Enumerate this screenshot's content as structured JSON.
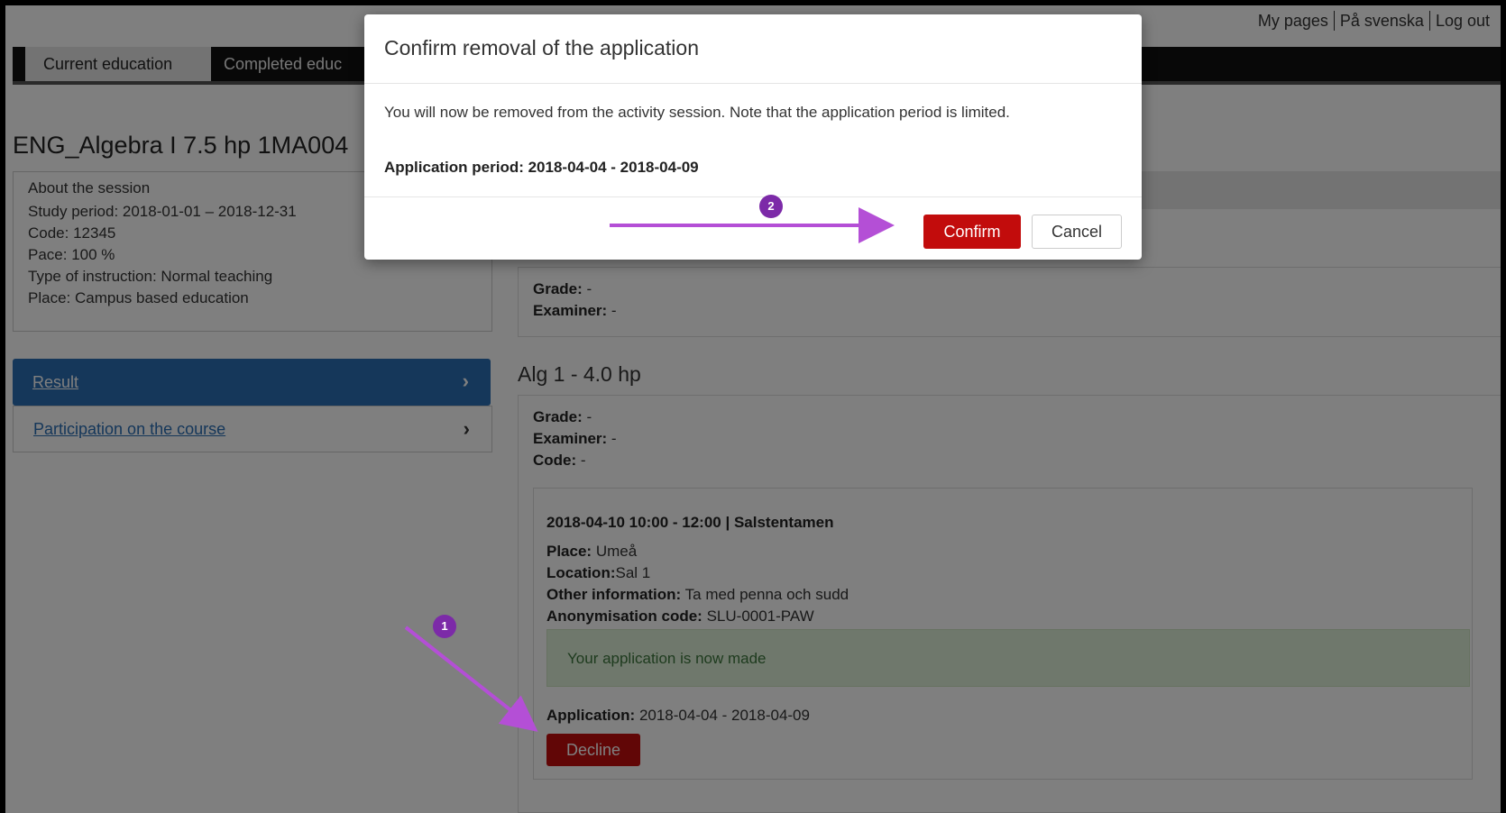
{
  "header": {
    "links": [
      "My pages",
      "På svenska",
      "Log out"
    ],
    "tabs": [
      "Current education",
      "Completed educ"
    ]
  },
  "course": {
    "title": "ENG_Algebra I 7.5 hp 1MA004",
    "about_label": "About the session",
    "study_period": "Study period:  2018-01-01 – 2018-12-31",
    "code": "Code:  12345",
    "pace": "Pace:  100 %",
    "instruction": "Type of instruction:  Normal teaching",
    "place": "Place:  Campus based education"
  },
  "sidebar": {
    "items": [
      {
        "label": "Result",
        "active": true
      },
      {
        "label": "Participation on the course",
        "active": false
      }
    ]
  },
  "grade_box": {
    "grade_label": "Grade:",
    "grade_value": " -",
    "examiner_label": "Examiner:",
    "examiner_value": " -"
  },
  "module": {
    "heading": "Alg 1 - 4.0 hp",
    "grade_label": "Grade:",
    "grade_value": " -",
    "examiner_label": "Examiner:",
    "examiner_value": " -",
    "code_label": "Code:",
    "code_value": " -",
    "exam": {
      "title": "2018-04-10 10:00 - 12:00 | Salstentamen",
      "place_label": "Place:",
      "place_value": " Umeå",
      "location_label": "Location:",
      "location_value": "Sal 1",
      "other_label": "Other information:",
      "other_value": " Ta med penna och sudd",
      "anon_label": "Anonymisation code:",
      "anon_value": " SLU-0001-PAW",
      "success_message": "Your application is now made",
      "application_label": "Application:",
      "application_value": " 2018-04-04 - 2018-04-09",
      "decline_label": "Decline"
    }
  },
  "modal": {
    "title": "Confirm removal of the application",
    "body": "You will now be removed from the activity session. Note that the application period is limited.",
    "period": "Application period: 2018-04-04 - 2018-04-09",
    "confirm_label": "Confirm",
    "cancel_label": "Cancel"
  },
  "annotations": {
    "badge1": "1",
    "badge2": "2",
    "arrow_color": "#b44fd6"
  }
}
